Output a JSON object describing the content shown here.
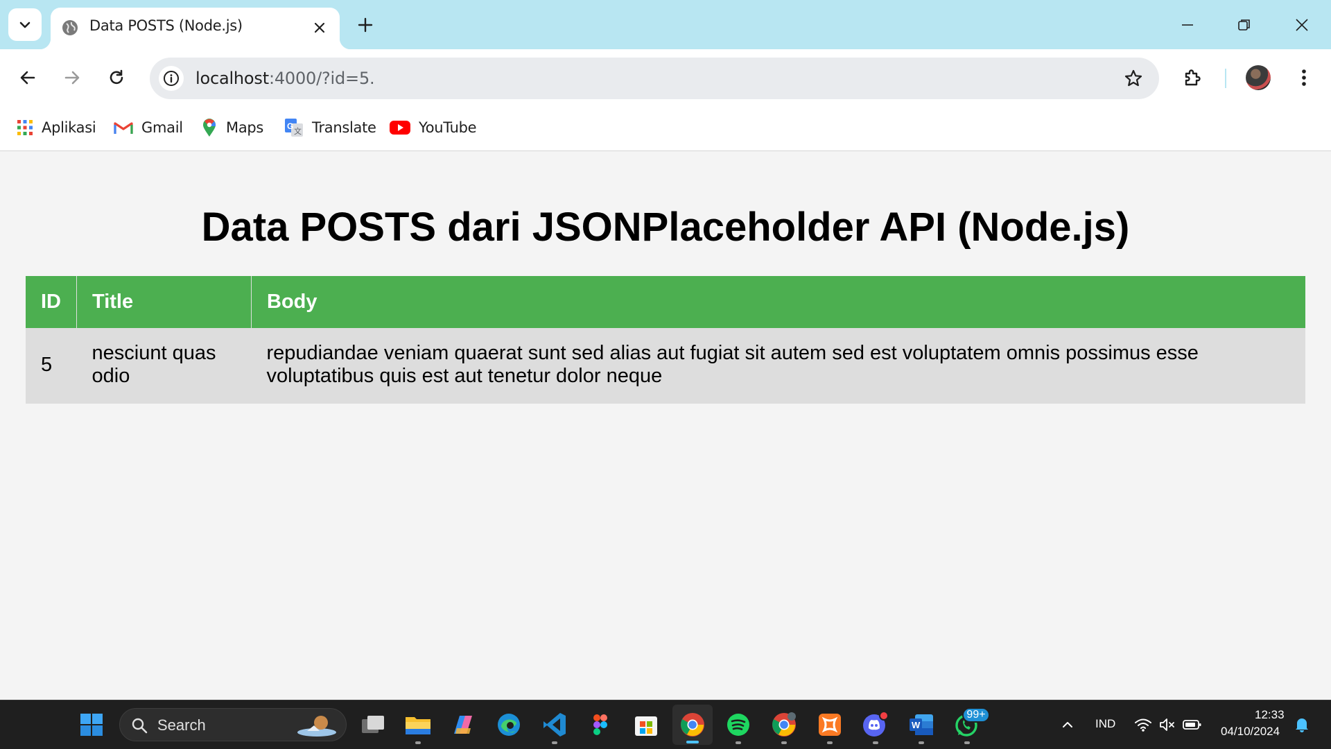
{
  "browser": {
    "tab_title": "Data POSTS (Node.js)",
    "url_host": "localhost",
    "url_path": ":4000/?id=5.",
    "bookmarks": [
      {
        "label": "Aplikasi",
        "icon": "apps-grid-icon"
      },
      {
        "label": "Gmail",
        "icon": "gmail-icon"
      },
      {
        "label": "Maps",
        "icon": "maps-pin-icon"
      },
      {
        "label": "Translate",
        "icon": "translate-icon"
      },
      {
        "label": "YouTube",
        "icon": "youtube-icon"
      }
    ]
  },
  "page": {
    "heading": "Data POSTS dari JSONPlaceholder API (Node.js)",
    "table": {
      "headers": [
        "ID",
        "Title",
        "Body"
      ],
      "rows": [
        {
          "id": "5",
          "title": "nesciunt quas odio",
          "body": "repudiandae veniam quaerat sunt sed alias aut fugiat sit autem sed est voluptatem omnis possimus esse voluptatibus quis est aut tenetur dolor neque"
        }
      ]
    }
  },
  "colors": {
    "header_green": "#4caf50",
    "row_gray": "#dddddd",
    "tabstrip": "#b8e6f2"
  },
  "taskbar": {
    "search_label": "Search",
    "notification_badge": "99+",
    "language": "IND",
    "time": "12:33",
    "date": "04/10/2024"
  }
}
